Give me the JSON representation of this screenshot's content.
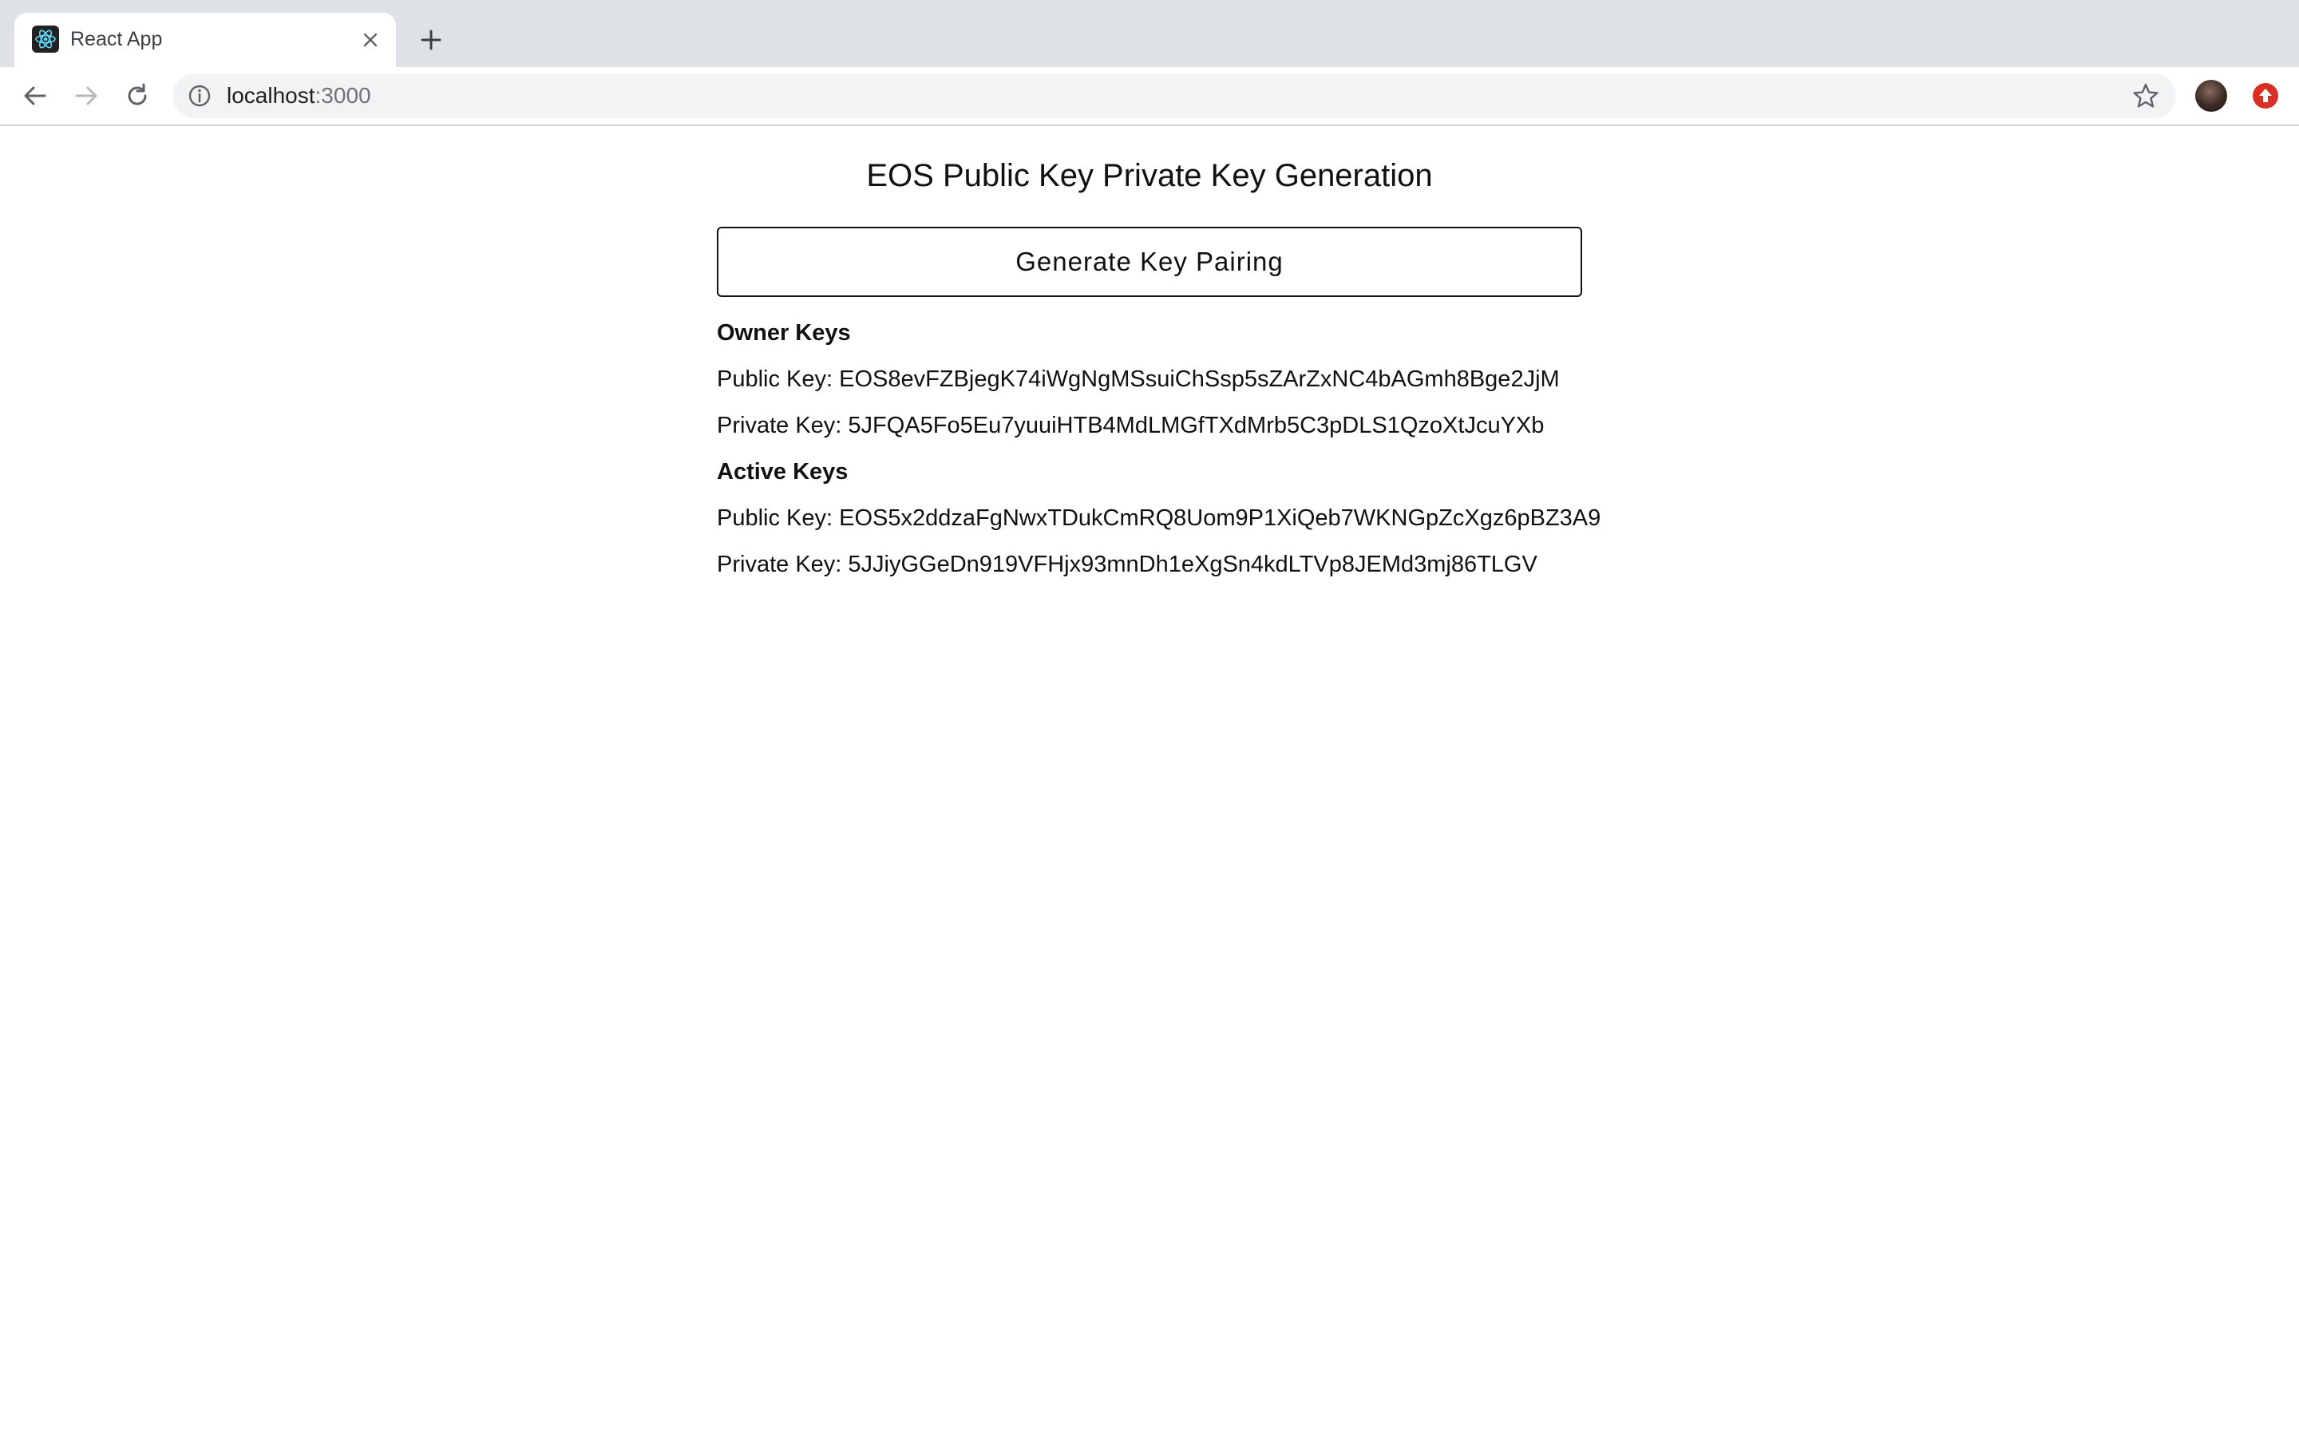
{
  "browser": {
    "tab_title": "React App",
    "url_host": "localhost",
    "url_port": ":3000"
  },
  "page": {
    "title": "EOS Public Key Private Key Generation",
    "generate_label": "Generate Key Pairing",
    "owner": {
      "heading": "Owner Keys",
      "public_line": "Public Key: EOS8evFZBjegK74iWgNgMSsuiChSsp5sZArZxNC4bAGmh8Bge2JjM",
      "private_line": "Private Key: 5JFQA5Fo5Eu7yuuiHTB4MdLMGfTXdMrb5C3pDLS1QzoXtJcuYXb"
    },
    "active": {
      "heading": "Active Keys",
      "public_line": "Public Key: EOS5x2ddzaFgNwxTDukCmRQ8Uom9P1XiQeb7WKNGpZcXgz6pBZ3A9",
      "private_line": "Private Key: 5JJiyGGeDn919VFHjx93mnDh1eXgSn4kdLTVp8JEMd3mj86TLGV"
    }
  },
  "icons": {
    "favicon": "react-logo-icon",
    "close": "close-icon",
    "new_tab": "plus-icon",
    "back": "arrow-back-icon",
    "forward": "arrow-forward-icon",
    "reload": "reload-icon",
    "info": "info-icon",
    "bookmark": "star-icon",
    "profile": "avatar",
    "extension": "extension-update-icon"
  },
  "colors": {
    "tabstrip_bg": "#dee1e6",
    "omnibox_bg": "#f1f3f4",
    "react_cyan": "#61dafb",
    "extension_red": "#d93025"
  }
}
